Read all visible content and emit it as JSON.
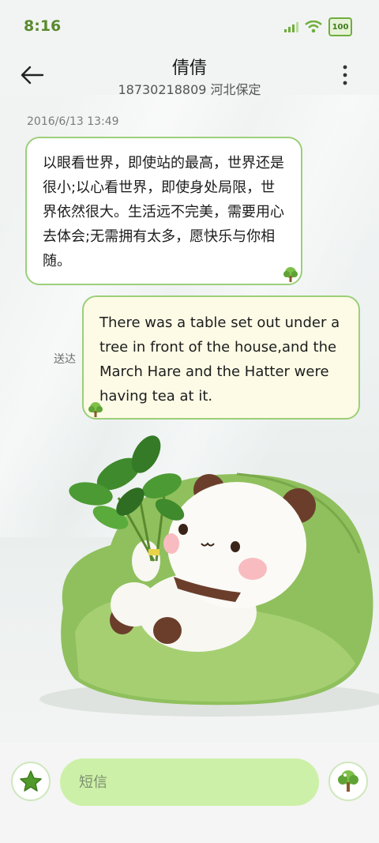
{
  "status": {
    "time": "8:16",
    "battery": "100",
    "icons": [
      "signal-icon",
      "wifi-icon",
      "battery-icon"
    ]
  },
  "header": {
    "contact_name": "倩倩",
    "contact_detail": "18730218809 河北保定"
  },
  "conversation": {
    "timestamp": "2016/6/13 13:49",
    "messages": [
      {
        "direction": "incoming",
        "text": "以眼看世界，即使站的最高，世界还是很小;以心看世界，即使身处局限，世界依然很大。生活远不完美，需要用心去体会;无需拥有太多，愿快乐与你相随。"
      },
      {
        "direction": "outgoing",
        "text": "There was a table set out under a tree in front of the house,and the March Hare and the Hatter were having tea at it.",
        "status": "送达"
      }
    ]
  },
  "composer": {
    "placeholder": "短信"
  },
  "colors": {
    "accent": "#6fae3b",
    "bubble_border": "#9ccf79",
    "input_bg": "#cdf0a8",
    "status_time": "#5a8a2f"
  }
}
